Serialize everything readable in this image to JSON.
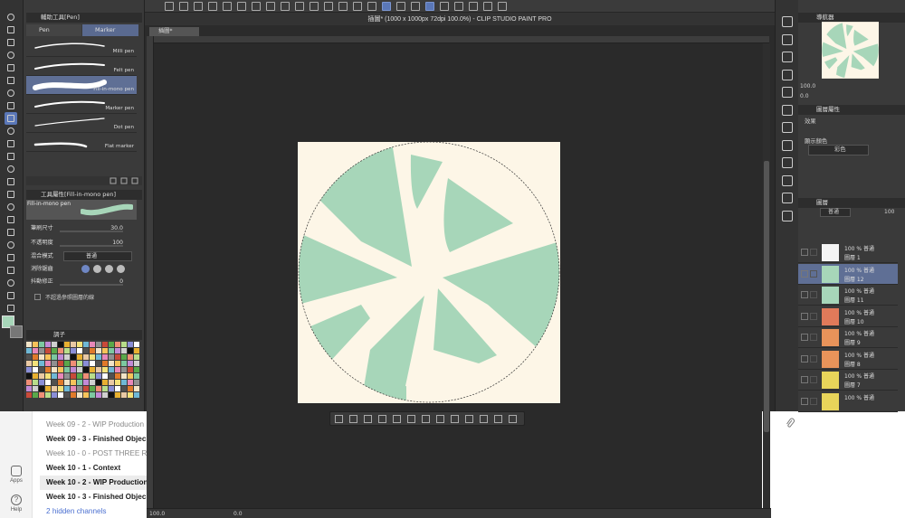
{
  "app": {
    "window_title": "插圖* (1000 x 1000px 72dpi 100.0%) - CLIP STUDIO PAINT PRO",
    "doc_tab": "插圖*"
  },
  "sub_tool_panel": {
    "title": "輔助工具[Pen]",
    "tabs": [
      "Pen",
      "Marker"
    ],
    "brushes": [
      {
        "name": "Milli pen",
        "selected": false
      },
      {
        "name": "Felt pen",
        "selected": false
      },
      {
        "name": "Fill-in-mono pen",
        "selected": true
      },
      {
        "name": "Marker pen",
        "selected": false
      },
      {
        "name": "Dot pen",
        "selected": false
      },
      {
        "name": "Flat marker",
        "selected": false
      }
    ]
  },
  "tool_property": {
    "title": "工具屬性[Fill-in-mono pen]",
    "brush_label": "Fill-in-mono pen",
    "rows": [
      {
        "label": "筆刷尺寸",
        "value": "30.0"
      },
      {
        "label": "不透明度",
        "value": "100"
      },
      {
        "label": "混合模式",
        "value": "普通"
      },
      {
        "label": "消除鋸齒",
        "value": ""
      },
      {
        "label": "抖動修正",
        "value": "0"
      }
    ],
    "checkbox_label": "不超過參照圖層的線"
  },
  "palette": {
    "title": "調子"
  },
  "canvas": {
    "bg_color": "#fdf6e7",
    "shape_color": "#a7d6b9"
  },
  "status": {
    "zoom": "100.0",
    "angle": "0.0"
  },
  "navigator": {
    "title": "導航器",
    "zoom": "100.0",
    "angle": "0.0"
  },
  "layer_property": {
    "title": "圖層屬性",
    "effect_label": "效果",
    "color_label": "顯示顏色",
    "color_value": "彩色"
  },
  "layers": {
    "title": "圖層",
    "blend_mode": "普通",
    "opacity": "100",
    "items": [
      {
        "pct": "100 % 普通",
        "name": "圖層 1",
        "selected": false,
        "thumb": "blank"
      },
      {
        "pct": "100 % 普通",
        "name": "圖層 12",
        "selected": true,
        "thumb": "green"
      },
      {
        "pct": "100 % 普通",
        "name": "圖層 11",
        "selected": false,
        "thumb": "green"
      },
      {
        "pct": "100 % 普通",
        "name": "圖層 10",
        "selected": false,
        "thumb": "red"
      },
      {
        "pct": "100 % 普通",
        "name": "圖層 9",
        "selected": false,
        "thumb": "orange"
      },
      {
        "pct": "100 % 普通",
        "name": "圖層 8",
        "selected": false,
        "thumb": "orange"
      },
      {
        "pct": "100 % 普通",
        "name": "圖層 7",
        "selected": false,
        "thumb": "yellow"
      },
      {
        "pct": "100 % 普通",
        "name": "",
        "selected": false,
        "thumb": "yellow"
      }
    ]
  },
  "background_app": {
    "rail": [
      {
        "label": "Apps",
        "icon": "apps-icon"
      },
      {
        "label": "Help",
        "icon": "help-icon"
      }
    ],
    "channels": [
      {
        "label": "Week 09 - 2 - WIP Production",
        "style": "muted"
      },
      {
        "label": "Week 09 - 3 - Finished Objec",
        "style": "bold"
      },
      {
        "label": "Week 10 - 0 - POST THREE RU",
        "style": "muted"
      },
      {
        "label": "Week 10 - 1 - Context",
        "style": "bold"
      },
      {
        "label": "Week 10 - 2 - WIP Production",
        "style": "selected"
      },
      {
        "label": "Week 10 - 3 - Finished Objec",
        "style": "bold"
      },
      {
        "label": "2 hidden channels",
        "style": "link"
      }
    ]
  }
}
